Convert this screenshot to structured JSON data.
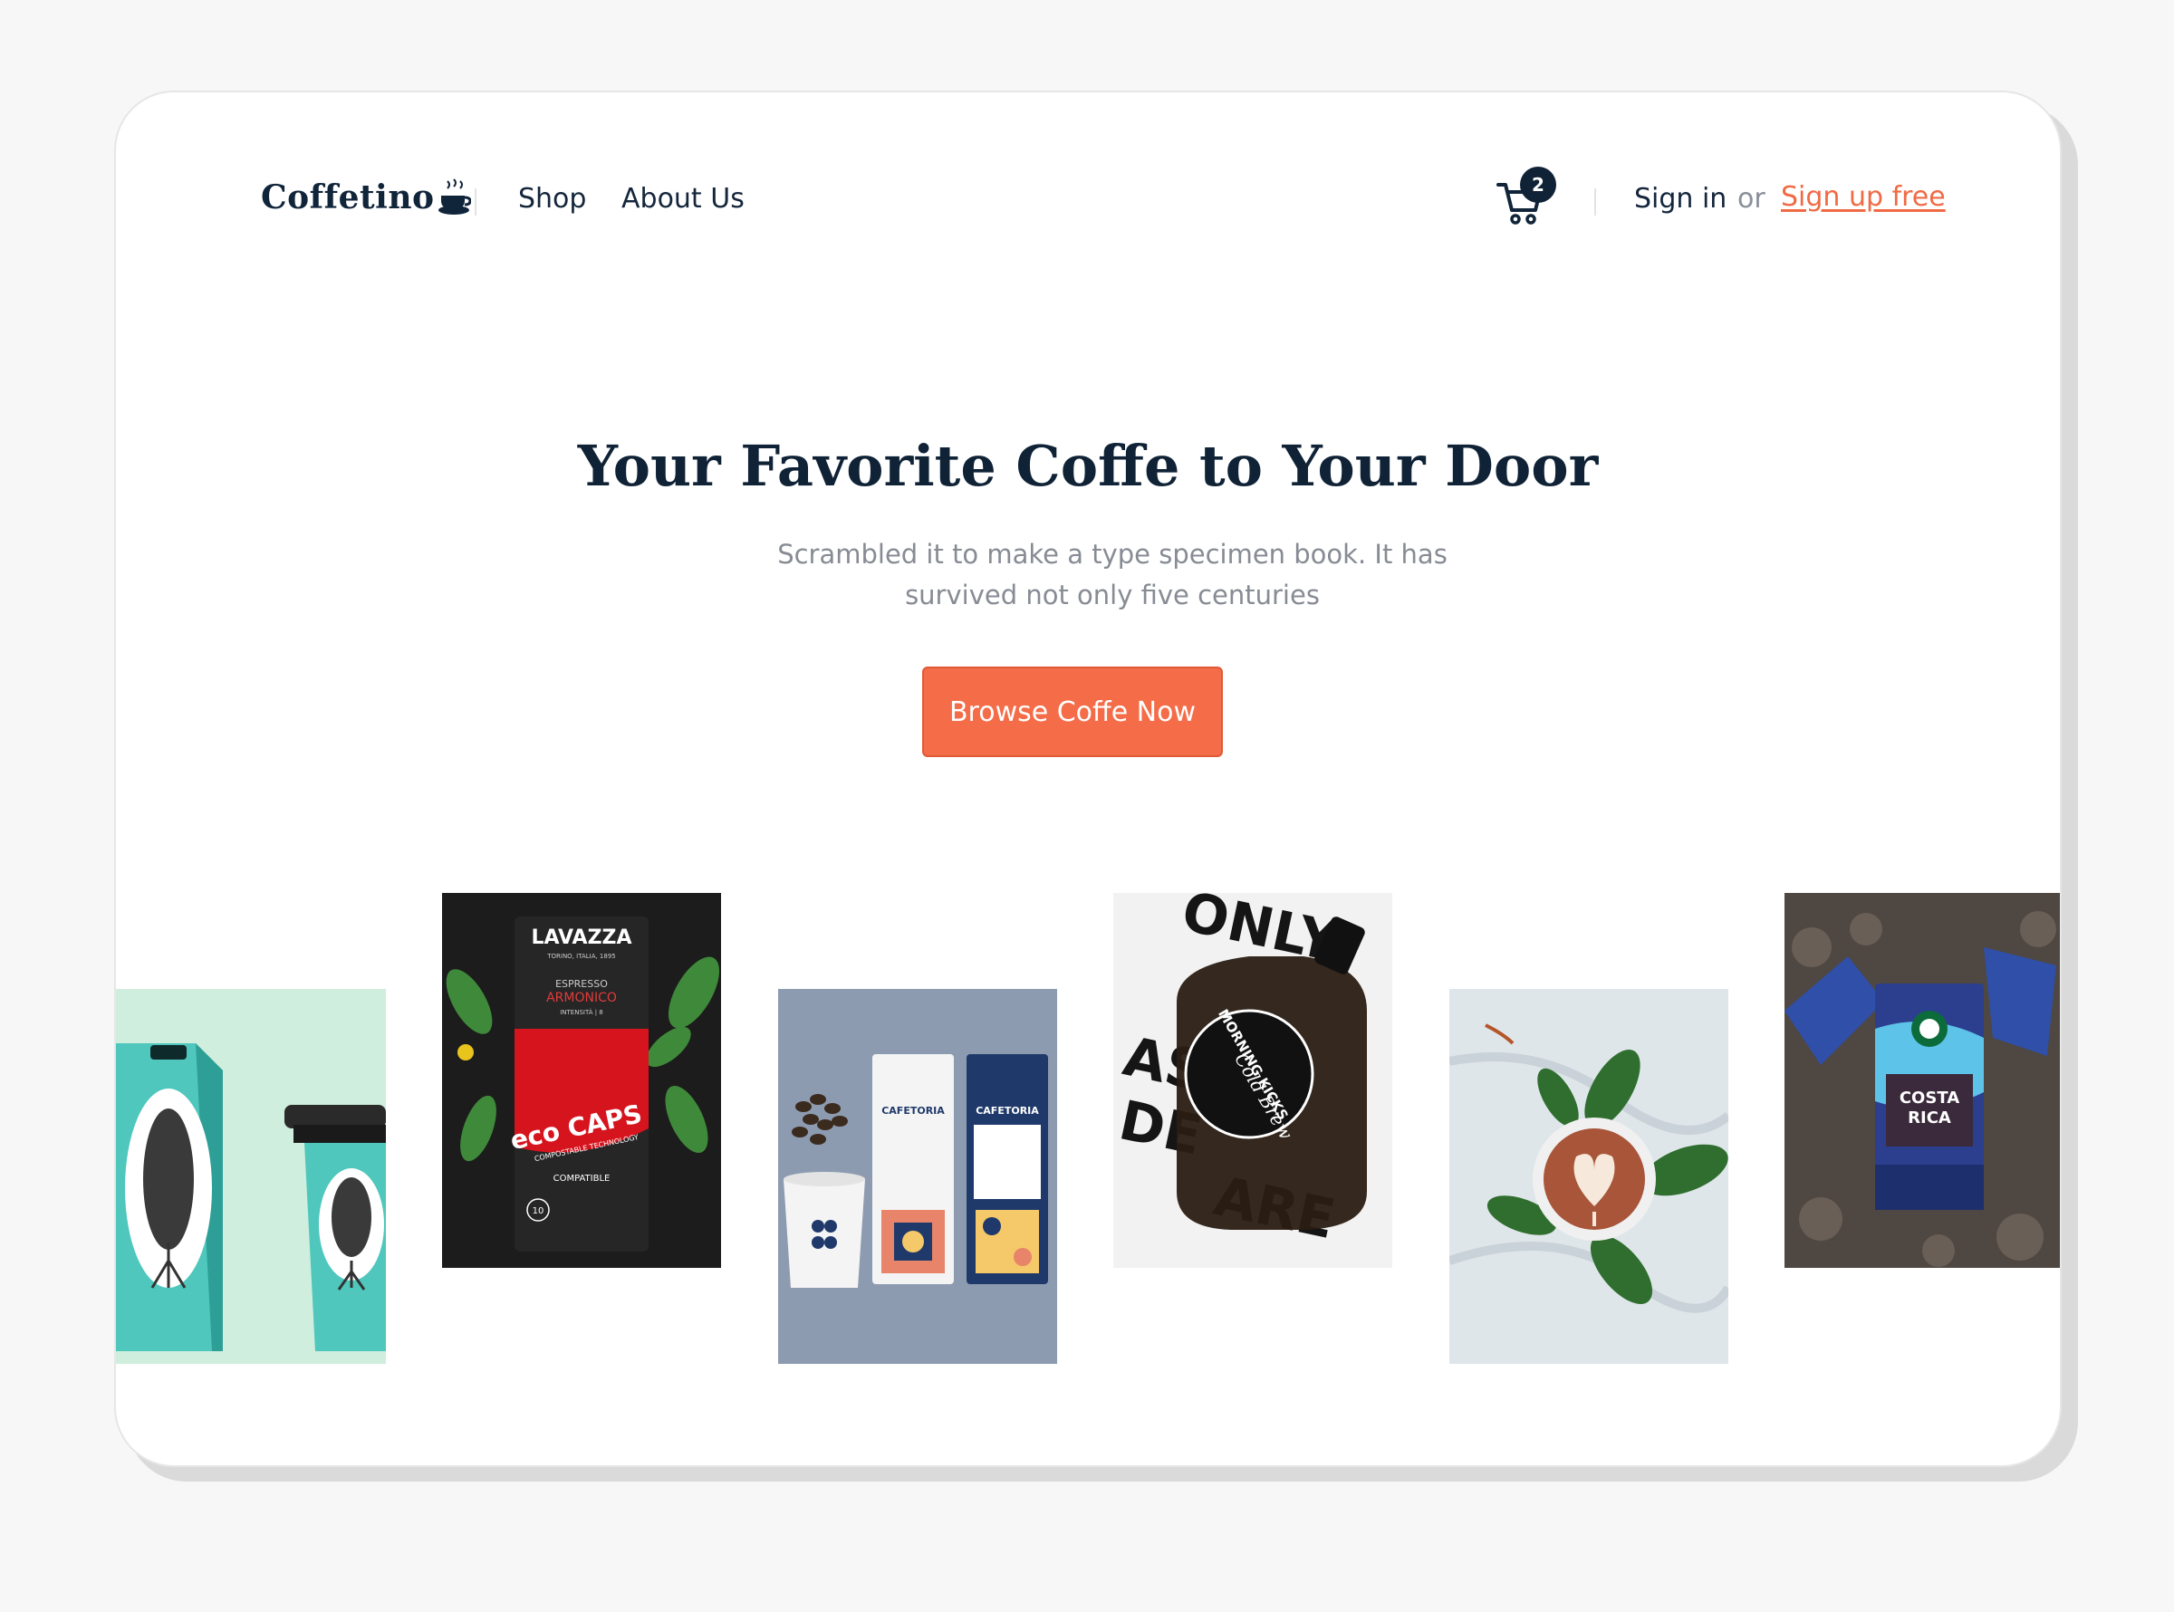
{
  "brand": {
    "name": "Coffetino",
    "logo_icon": "coffee-cup-icon"
  },
  "nav": {
    "links": [
      {
        "label": "Shop"
      },
      {
        "label": "About Us"
      }
    ]
  },
  "cart": {
    "icon": "cart-icon",
    "count": "2"
  },
  "auth": {
    "signin_label": "Sign in",
    "or_label": "or",
    "signup_label": "Sign up free"
  },
  "hero": {
    "title": "Your Favorite Coffe to Your Door",
    "subtitle": "Scrambled it to make a type specimen book. It has survived not only five centuries",
    "cta_label": "Browse Coffe Now"
  },
  "gallery": [
    {
      "name": "coffee-bag-and-cup"
    },
    {
      "name": "lavazza-eco-caps",
      "texts": [
        "LAVAZZA",
        "TORINO, ITALIA, 1895",
        "ESPRESSO",
        "ARMONICO",
        "INTENSITÀ | 8",
        "eco CAPS",
        "COMPOSTABLE TECHNOLOGY",
        "COMPATIBLE",
        "10"
      ]
    },
    {
      "name": "cafetoria-bags",
      "texts": [
        "CAFETORIA",
        "CAFETORIA"
      ]
    },
    {
      "name": "morning-kicks-cold-brew",
      "texts": [
        "ONLY",
        "MORNING KICKS",
        "Cold Brew"
      ]
    },
    {
      "name": "latte-art-cup"
    },
    {
      "name": "costa-rica-coffee-bag",
      "texts": [
        "COSTA",
        "RICA"
      ]
    }
  ],
  "colors": {
    "accent": "#f46c48",
    "dark": "#0f2236",
    "muted": "#878b94"
  }
}
